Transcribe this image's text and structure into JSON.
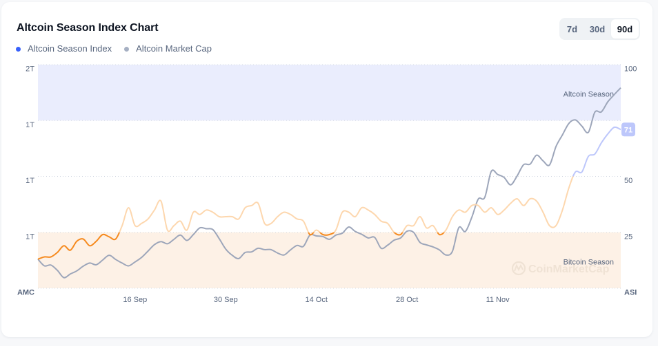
{
  "chart_data": {
    "type": "line",
    "title": "Altcoin Season Index Chart",
    "legend_position": "top-left",
    "legend": [
      {
        "label": "Altcoin Season Index",
        "color": "#3861FB"
      },
      {
        "label": "Altcoin Market Cap",
        "color": "#A6B0C3"
      }
    ],
    "grid": "dotted horizontal",
    "x": {
      "type": "day-index",
      "count": 91,
      "ticks": [
        {
          "day": 15,
          "label": "16 Sep"
        },
        {
          "day": 29,
          "label": "30 Sep"
        },
        {
          "day": 43,
          "label": "14 Oct"
        },
        {
          "day": 57,
          "label": "28 Oct"
        },
        {
          "day": 71,
          "label": "11 Nov"
        }
      ]
    },
    "y_left": {
      "label": "AMC",
      "unit": "T",
      "range": [
        0.8,
        1.6
      ],
      "ticks": [
        {
          "value": 1.0,
          "label": "1T"
        },
        {
          "value": 1.2,
          "label": "1T"
        },
        {
          "value": 1.4,
          "label": "1T"
        },
        {
          "value": 1.6,
          "label": "2T"
        }
      ]
    },
    "y_right": {
      "label": "ASI",
      "range": [
        0,
        100
      ],
      "ticks": [
        {
          "value": 25,
          "label": "25"
        },
        {
          "value": 50,
          "label": "50"
        },
        {
          "value": 100,
          "label": "100"
        }
      ]
    },
    "bands": [
      {
        "name": "Altcoin Season",
        "from": 75,
        "to": 100,
        "color": "#EAEDFD"
      },
      {
        "name": "Bitcoin Season",
        "from": 0,
        "to": 25,
        "color": "#FDF1E6"
      }
    ],
    "series": [
      {
        "name": "Altcoin Season Index",
        "axis": "right",
        "values": [
          13,
          14,
          14,
          16,
          19,
          17,
          21,
          22,
          19,
          21,
          24,
          23,
          22,
          28,
          36,
          28,
          29,
          31,
          35,
          39,
          26,
          28,
          30,
          26,
          34,
          33,
          35,
          34,
          32,
          32,
          32,
          31,
          36,
          37,
          38,
          29,
          29,
          32,
          34,
          33,
          31,
          30,
          24,
          26,
          24,
          24,
          26,
          34,
          34,
          32,
          36,
          35,
          33,
          30,
          29,
          25,
          24,
          28,
          28,
          32,
          27,
          28,
          24,
          26,
          32,
          35,
          34,
          37,
          37,
          34,
          36,
          33,
          35,
          38,
          40,
          37,
          40,
          39,
          34,
          28,
          28,
          35,
          45,
          52,
          52,
          59,
          60,
          65,
          69,
          72,
          71
        ],
        "zones": [
          {
            "from": 0,
            "to": 25,
            "color": "#F68A1E"
          },
          {
            "from": 25,
            "to": 50,
            "color": "#FDD7AE"
          },
          {
            "from": 50,
            "to": 75,
            "color": "#BDC7FB"
          },
          {
            "from": 75,
            "to": 100,
            "color": "#3861FB"
          }
        ]
      },
      {
        "name": "Altcoin Market Cap",
        "axis": "left",
        "color": "#9DA6BA",
        "values": [
          0.904,
          0.88,
          0.883,
          0.864,
          0.838,
          0.851,
          0.862,
          0.879,
          0.89,
          0.884,
          0.901,
          0.918,
          0.903,
          0.89,
          0.88,
          0.894,
          0.91,
          0.933,
          0.956,
          0.967,
          0.959,
          0.975,
          0.99,
          0.971,
          0.992,
          1.016,
          1.013,
          1.01,
          0.977,
          0.94,
          0.918,
          0.906,
          0.928,
          0.93,
          0.943,
          0.938,
          0.938,
          0.926,
          0.919,
          0.937,
          0.953,
          0.95,
          0.99,
          0.987,
          0.985,
          0.975,
          0.99,
          0.997,
          1.019,
          1.003,
          0.993,
          0.98,
          0.982,
          0.943,
          0.954,
          0.972,
          0.98,
          1.004,
          1.0,
          0.964,
          0.955,
          0.948,
          0.937,
          0.919,
          0.932,
          1.017,
          1.003,
          1.054,
          1.119,
          1.125,
          1.218,
          1.207,
          1.196,
          1.17,
          1.202,
          1.242,
          1.244,
          1.276,
          1.256,
          1.241,
          1.307,
          1.349,
          1.39,
          1.402,
          1.38,
          1.358,
          1.43,
          1.431,
          1.467,
          1.493,
          1.517
        ]
      }
    ],
    "current_value_badge": {
      "value": 71,
      "label": "71",
      "color": "#BDC7FB"
    },
    "watermark": "CoinMarketCap"
  },
  "range_selector": {
    "options": [
      {
        "label": "7d",
        "active": false
      },
      {
        "label": "30d",
        "active": false
      },
      {
        "label": "90d",
        "active": true
      }
    ]
  }
}
